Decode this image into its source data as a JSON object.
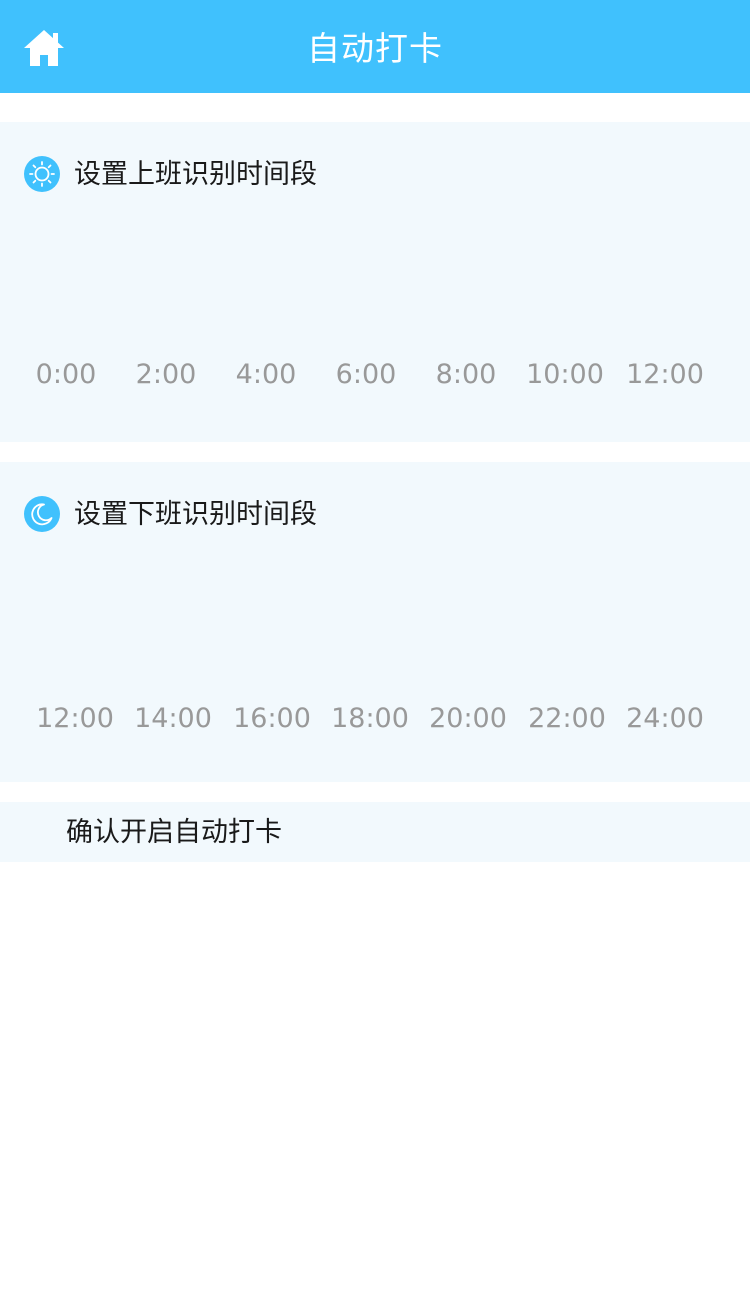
{
  "header": {
    "title": "自动打卡",
    "home_icon": "home-icon",
    "background_color": "#40c1fd"
  },
  "onwork": {
    "title": "设置上班识别时间段",
    "icon": "sun-icon",
    "ticks": [
      "0:00",
      "2:00",
      "4:00",
      "6:00",
      "8:00",
      "10:00",
      "12:00"
    ]
  },
  "offwork": {
    "title": "设置下班识别时间段",
    "icon": "moon-icon",
    "ticks": [
      "12:00",
      "14:00",
      "16:00",
      "18:00",
      "20:00",
      "22:00",
      "24:00"
    ]
  },
  "confirm": {
    "label": "确认开启自动打卡"
  },
  "colors": {
    "accent": "#40c1fd",
    "card_bg": "#f2f9fd",
    "tick_text": "#999999",
    "body_text": "#1a1a1a"
  }
}
